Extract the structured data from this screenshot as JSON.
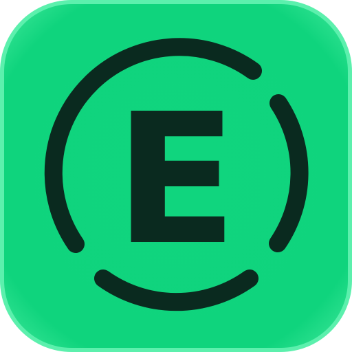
{
  "app_icon": {
    "letter": "E",
    "colors": {
      "background": "#0ed37c",
      "background_edge": "#5cf0ad",
      "glyph": "#0a2a1f"
    }
  }
}
